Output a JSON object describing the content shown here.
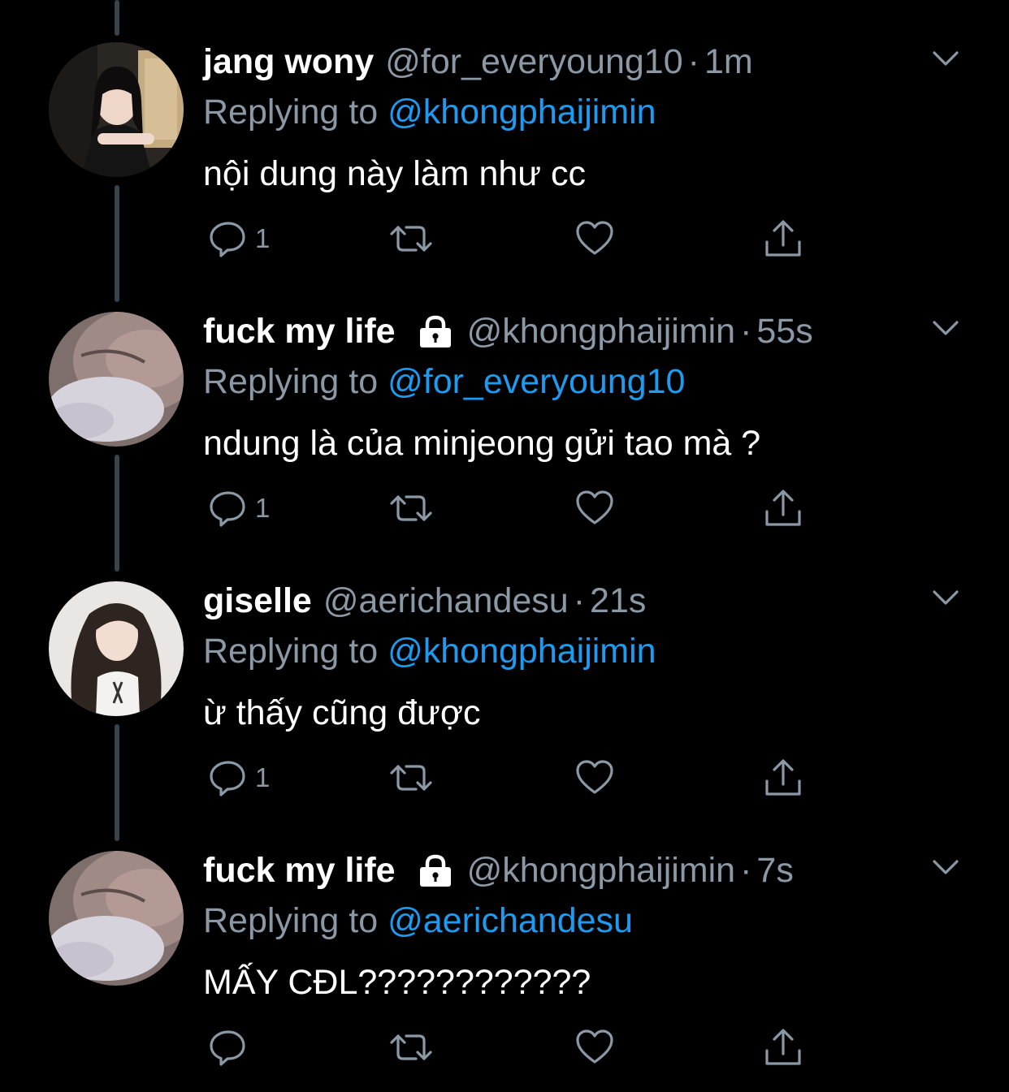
{
  "tweets": [
    {
      "display_name": "jang wony",
      "handle": "@for_everyoung10",
      "time": "1m",
      "locked": false,
      "replying_label": "Replying to",
      "replying_to": "@khongphaijimin",
      "text": "nội dung này làm như cc",
      "reply_count": "1"
    },
    {
      "display_name": "fuck my life",
      "handle": "@khongphaijimin",
      "time": "55s",
      "locked": true,
      "replying_label": "Replying to",
      "replying_to": "@for_everyoung10",
      "text": "ndung là của minjeong gửi tao mà ?",
      "reply_count": "1"
    },
    {
      "display_name": "giselle",
      "handle": "@aerichandesu",
      "time": "21s",
      "locked": false,
      "replying_label": "Replying to",
      "replying_to": "@khongphaijimin",
      "text": "ừ thấy cũng được",
      "reply_count": "1"
    },
    {
      "display_name": "fuck my life",
      "handle": "@khongphaijimin",
      "time": "7s",
      "locked": true,
      "replying_label": "Replying to",
      "replying_to": "@aerichandesu",
      "text": "MẤY CĐL????????????",
      "reply_count": ""
    }
  ],
  "separator": "·",
  "icons": {
    "reply": "reply-icon",
    "retweet": "retweet-icon",
    "like": "heart-icon",
    "share": "share-icon",
    "more": "chevron-down-icon",
    "protected": "lock-icon"
  },
  "colors": {
    "background": "#000000",
    "text_primary": "#ffffff",
    "text_secondary": "#8b98a5",
    "link": "#1d9bf0",
    "thread_line": "#38444d"
  }
}
